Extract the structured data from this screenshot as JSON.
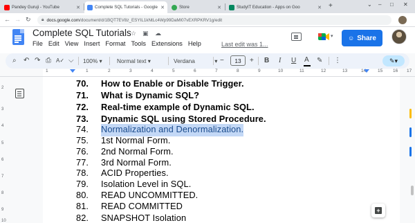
{
  "browser": {
    "tabs": [
      {
        "label": "Pandey Guruji - YouTube",
        "favicon_color": "#ff0000",
        "active": false
      },
      {
        "label": "Complete SQL Tutorials - Google",
        "favicon_color": "#4285f4",
        "active": true
      },
      {
        "label": "Store",
        "favicon_color": "#34a853",
        "active": false
      },
      {
        "label": "StudyIT Education - Apps on Goo",
        "favicon_color": "#01875f",
        "active": false
      }
    ],
    "new_tab_label": "+",
    "window_controls": [
      "⌄",
      "–",
      "□",
      "✕"
    ],
    "url_domain": "docs.google.com",
    "url_path": "/document/d/1BQT7EV8z_ESYIL1kNtLc4Wp99DaMl07vEXRPKRV1g/edit"
  },
  "docs": {
    "title": "Complete SQL Tutorials",
    "title_icons": [
      "☆",
      "▣",
      "☁"
    ],
    "menu": [
      "File",
      "Edit",
      "View",
      "Insert",
      "Format",
      "Tools",
      "Extensions",
      "Help"
    ],
    "last_edit": "Last edit was 1...",
    "share_label": "Share",
    "share_icon": "☺"
  },
  "toolbar": {
    "search": "⌕",
    "undo": "↶",
    "redo": "↷",
    "print": "⎙",
    "spell": "A✓",
    "paint": "⌵",
    "zoom": "100%",
    "style": "Normal text",
    "font": "Verdana",
    "font_size": "13",
    "minus": "−",
    "plus": "+",
    "bold": "B",
    "italic": "I",
    "underline": "U",
    "text_color": "A",
    "highlight": "✎",
    "more": "⋮",
    "editing_mode": "✎▾",
    "caret": "▾"
  },
  "ruler": {
    "numbers": [
      "1",
      "1",
      "2",
      "3",
      "4",
      "5",
      "6",
      "7",
      "8",
      "9",
      "10",
      "11",
      "12",
      "13",
      "14",
      "15",
      "16",
      "17"
    ],
    "vertical_numbers": [
      "2",
      "3",
      "4",
      "5",
      "6",
      "7",
      "8",
      "9",
      "10"
    ]
  },
  "document_lines": [
    {
      "num": "70.",
      "text": "How to Enable or Disable Trigger.",
      "bold": true
    },
    {
      "num": "71.",
      "text": "What is Dynamic SQL?",
      "bold": true
    },
    {
      "num": "72.",
      "text": "Real-time example of Dynamic SQL.",
      "bold": true
    },
    {
      "num": "73.",
      "text": "Dynamic SQL using Stored Procedure.",
      "bold": true
    },
    {
      "num": "74.",
      "text": "Normalization and Denormalization.",
      "bold": false,
      "highlighted": true
    },
    {
      "num": "75.",
      "text": "1st Normal Form.",
      "bold": false
    },
    {
      "num": "76.",
      "text": "2nd Normal Form.",
      "bold": false
    },
    {
      "num": "77.",
      "text": "3rd Normal Form.",
      "bold": false
    },
    {
      "num": "78.",
      "text": "ACID Properties.",
      "bold": false
    },
    {
      "num": "79.",
      "text": "Isolation Level in SQL.",
      "bold": false
    },
    {
      "num": "80.",
      "text": "READ UNCOMMITTED.",
      "bold": false
    },
    {
      "num": "81.",
      "text": "READ COMMITTED",
      "bold": false
    },
    {
      "num": "82.",
      "text": "SNAPSHOT Isolation",
      "bold": false
    }
  ],
  "colors": {
    "accent": "#1a73e8",
    "selection": "#c3d8f6",
    "toolbar_bg": "#edf2fa"
  }
}
